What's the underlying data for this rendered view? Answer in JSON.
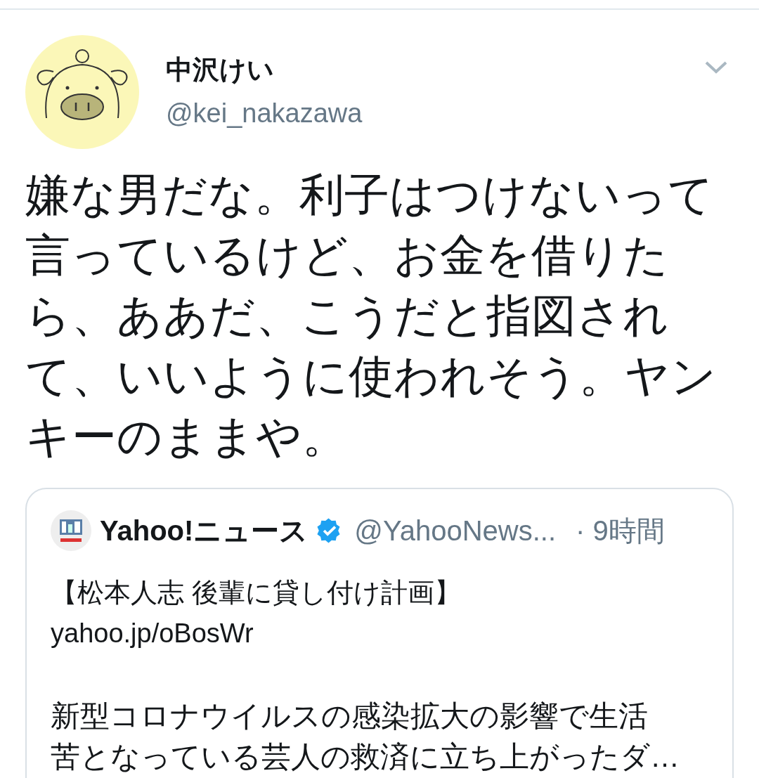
{
  "tweet": {
    "author": {
      "name": "中沢けい",
      "handle": "@kei_nakazawa"
    },
    "text": "嫌な男だな。利子はつけないって言っているけど、お金を借りたら、ああだ、こうだと指図されて、いいように使われそう。ヤンキーのままや。",
    "quoted": {
      "author": {
        "name": "Yahoo!ニュース",
        "verified": true,
        "handle": "@YahooNews...",
        "time": "· 9時間"
      },
      "headline": "【松本人志 後輩に貸し付け計画】",
      "link": "yahoo.jp/oBosWr",
      "body_lines": [
        "新型コロナウイルスの感染拡大の影響で生活",
        "苦となっている芸人の救済に立ち上がったダ…"
      ]
    }
  }
}
